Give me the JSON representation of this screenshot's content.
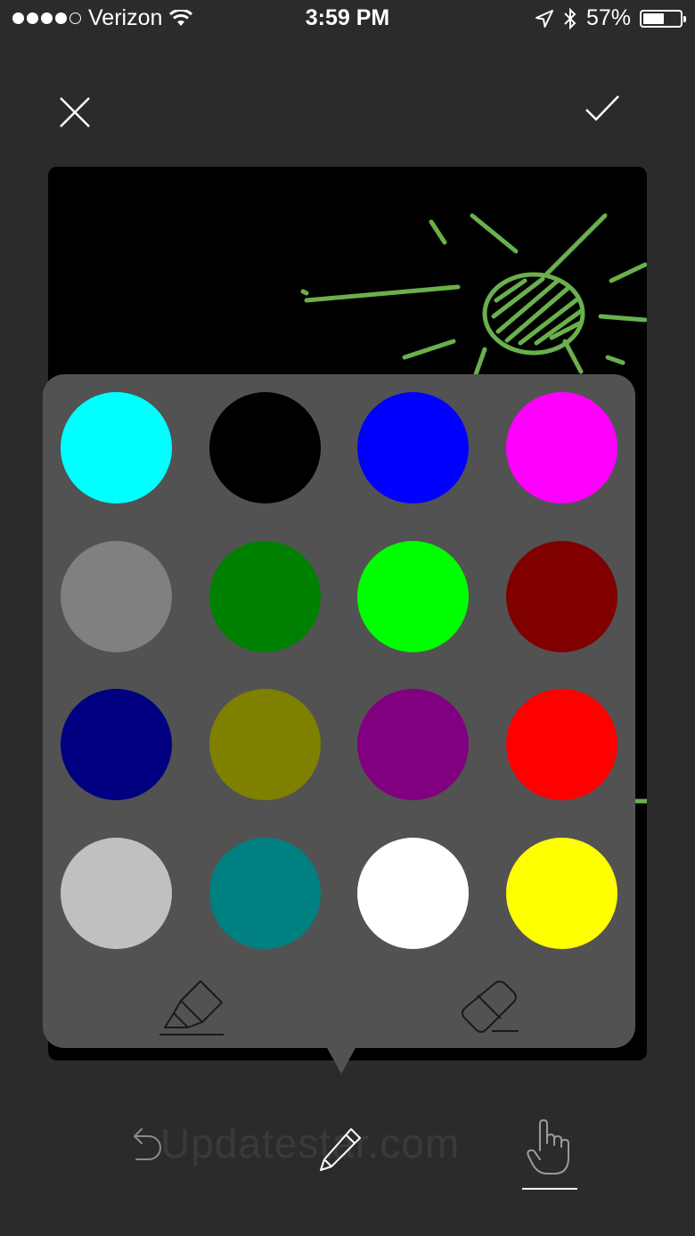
{
  "status_bar": {
    "carrier": "Verizon",
    "time": "3:59 PM",
    "battery": "57%",
    "battery_level": 0.57,
    "signal_bars_filled": 4,
    "signal_bars_total": 5,
    "icons": [
      "wifi-icon",
      "location-arrow-icon",
      "bluetooth-icon",
      "battery-icon"
    ]
  },
  "header": {
    "close_icon": "close-icon",
    "confirm_icon": "checkmark-icon"
  },
  "canvas": {
    "background": "#000000",
    "stroke_color": "#6ab04c"
  },
  "palette": {
    "colors": [
      "#00ffff",
      "#000000",
      "#0000ff",
      "#ff00ff",
      "#808080",
      "#008000",
      "#00ff00",
      "#800000",
      "#000080",
      "#808000",
      "#800080",
      "#ff0000",
      "#c0c0c0",
      "#008080",
      "#ffffff",
      "#ffff00"
    ],
    "tools": [
      "highlighter-icon",
      "eraser-icon"
    ]
  },
  "bottom_bar": {
    "tools": [
      "undo-icon",
      "pencil-icon",
      "hand-pointer-icon"
    ],
    "active_tool": "hand-pointer-icon",
    "watermark": "Updatestar.com"
  }
}
